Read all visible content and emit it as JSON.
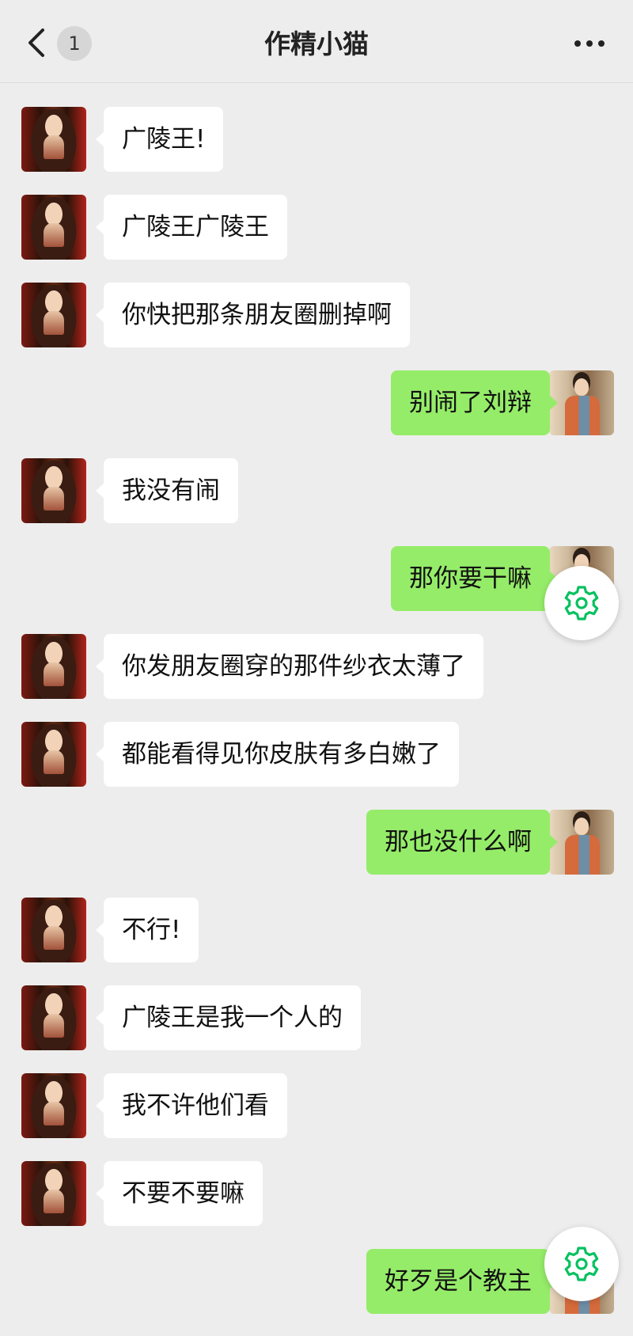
{
  "header": {
    "back_icon": "chevron-left-icon",
    "unread_count": "1",
    "title": "作精小猫",
    "more_icon": "more-dots-icon"
  },
  "messages": [
    {
      "side": "in",
      "text": "广陵王!"
    },
    {
      "side": "in",
      "text": "广陵王广陵王"
    },
    {
      "side": "in",
      "text": "你快把那条朋友圈删掉啊"
    },
    {
      "side": "out",
      "text": "别闹了刘辩"
    },
    {
      "side": "in",
      "text": "我没有闹"
    },
    {
      "side": "out",
      "text": "那你要干嘛"
    },
    {
      "side": "in",
      "text": "你发朋友圈穿的那件纱衣太薄了"
    },
    {
      "side": "in",
      "text": "都能看得见你皮肤有多白嫩了"
    },
    {
      "side": "out",
      "text": "那也没什么啊"
    },
    {
      "side": "in",
      "text": "不行!"
    },
    {
      "side": "in",
      "text": "广陵王是我一个人的"
    },
    {
      "side": "in",
      "text": "我不许他们看"
    },
    {
      "side": "in",
      "text": "不要不要嘛"
    },
    {
      "side": "out",
      "text": "好歹是个教主"
    }
  ],
  "floating_buttons": {
    "icon": "gear-icon",
    "color": "#07c160"
  },
  "colors": {
    "background": "#ededed",
    "incoming_bubble": "#ffffff",
    "outgoing_bubble": "#95ec69"
  }
}
